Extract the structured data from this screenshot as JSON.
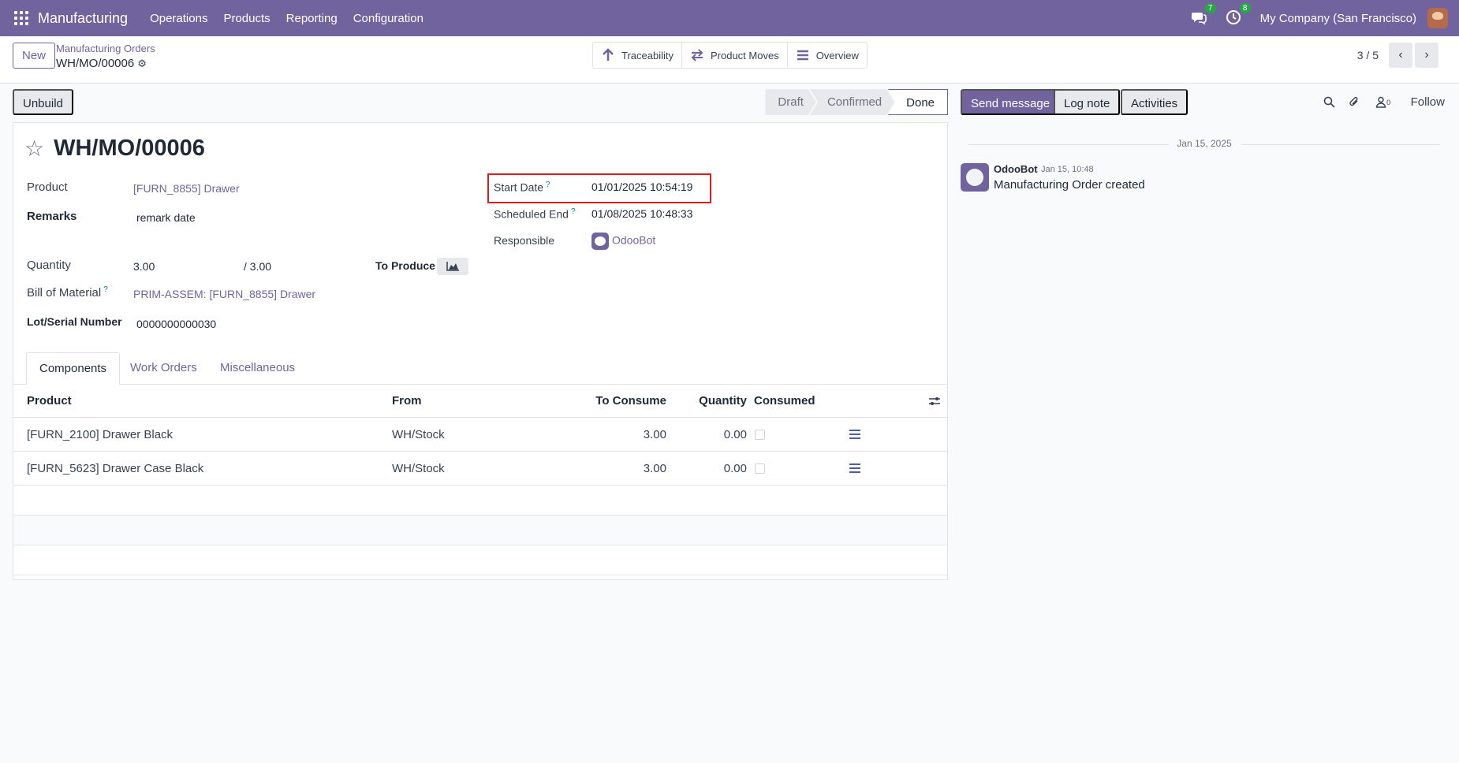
{
  "navbar": {
    "app_name": "Manufacturing",
    "menu": [
      "Operations",
      "Products",
      "Reporting",
      "Configuration"
    ],
    "messages_count": "7",
    "activities_count": "8",
    "company": "My Company (San Francisco)"
  },
  "control": {
    "new_label": "New",
    "breadcrumb_parent": "Manufacturing Orders",
    "breadcrumb_current": "WH/MO/00006",
    "smart_buttons": [
      "Traceability",
      "Product Moves",
      "Overview"
    ],
    "pager": "3 / 5"
  },
  "status": {
    "unbuild_label": "Unbuild",
    "stages": [
      "Draft",
      "Confirmed",
      "Done"
    ],
    "active_stage": "Done"
  },
  "form": {
    "title": "WH/MO/00006",
    "product_label": "Product",
    "product_value": "[FURN_8855] Drawer",
    "remarks_label": "Remarks",
    "remarks_value": "remark date",
    "quantity_label": "Quantity",
    "quantity_value": "3.00",
    "quantity_total": "/ 3.00",
    "to_produce_label": "To Produce",
    "bom_label": "Bill of Material",
    "bom_value": "PRIM-ASSEM: [FURN_8855] Drawer",
    "lot_label": "Lot/Serial Number",
    "lot_value": "0000000000030",
    "start_date_label": "Start Date",
    "start_date_value": "01/01/2025 10:54:19",
    "scheduled_end_label": "Scheduled End",
    "scheduled_end_value": "01/08/2025 10:48:33",
    "responsible_label": "Responsible",
    "responsible_value": "OdooBot",
    "help_mark": "?"
  },
  "tabs": [
    "Components",
    "Work Orders",
    "Miscellaneous"
  ],
  "table": {
    "headers": [
      "Product",
      "From",
      "To Consume",
      "Quantity",
      "Consumed"
    ],
    "rows": [
      {
        "product": "[FURN_2100] Drawer Black",
        "from": "WH/Stock",
        "to_consume": "3.00",
        "quantity": "0.00"
      },
      {
        "product": "[FURN_5623] Drawer Case Black",
        "from": "WH/Stock",
        "to_consume": "3.00",
        "quantity": "0.00"
      }
    ]
  },
  "chatter": {
    "send_message": "Send message",
    "log_note": "Log note",
    "activities": "Activities",
    "followers_count": "0",
    "follow": "Follow",
    "date_separator": "Jan 15, 2025",
    "message": {
      "author": "OdooBot",
      "time": "Jan 15, 10:48",
      "body": "Manufacturing Order created"
    }
  },
  "colors": {
    "brand": "#71639e",
    "highlight_box": "#d91d1d",
    "badge": "#28a745"
  }
}
